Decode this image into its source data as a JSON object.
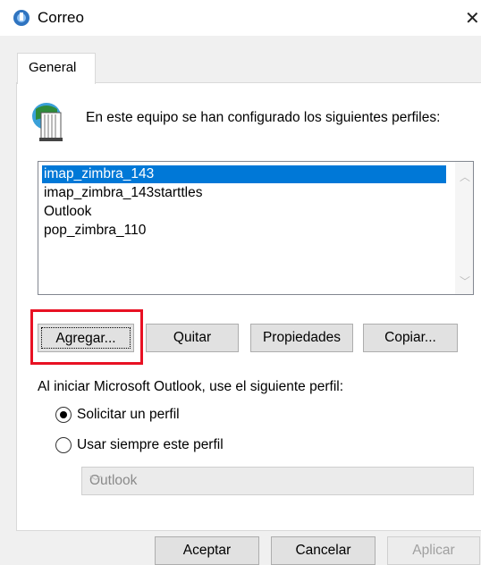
{
  "window": {
    "title": "Correo",
    "close_glyph": "✕"
  },
  "tabs": [
    {
      "label": "General"
    }
  ],
  "intro_text": "En este equipo se han configurado los siguientes perfiles:",
  "profiles": {
    "items": [
      "imap_zimbra_143",
      "imap_zimbra_143starttles",
      "Outlook",
      "pop_zimbra_110"
    ],
    "selected_index": 0
  },
  "buttons": {
    "add": "Agregar...",
    "remove": "Quitar",
    "properties": "Propiedades",
    "copy": "Copiar..."
  },
  "startup": {
    "label": "Al iniciar Microsoft Outlook, use el siguiente perfil:",
    "option_prompt": "Solicitar un perfil",
    "option_always": "Usar siempre este perfil",
    "selected_option": "prompt",
    "profile_select_value": "Outlook"
  },
  "footer": {
    "ok": "Aceptar",
    "cancel": "Cancelar",
    "apply": "Aplicar"
  },
  "colors": {
    "selection": "#0078d7",
    "highlight_box": "#e81123"
  },
  "icons": {
    "title": "mail-icon",
    "profile": "profile-book-icon"
  }
}
